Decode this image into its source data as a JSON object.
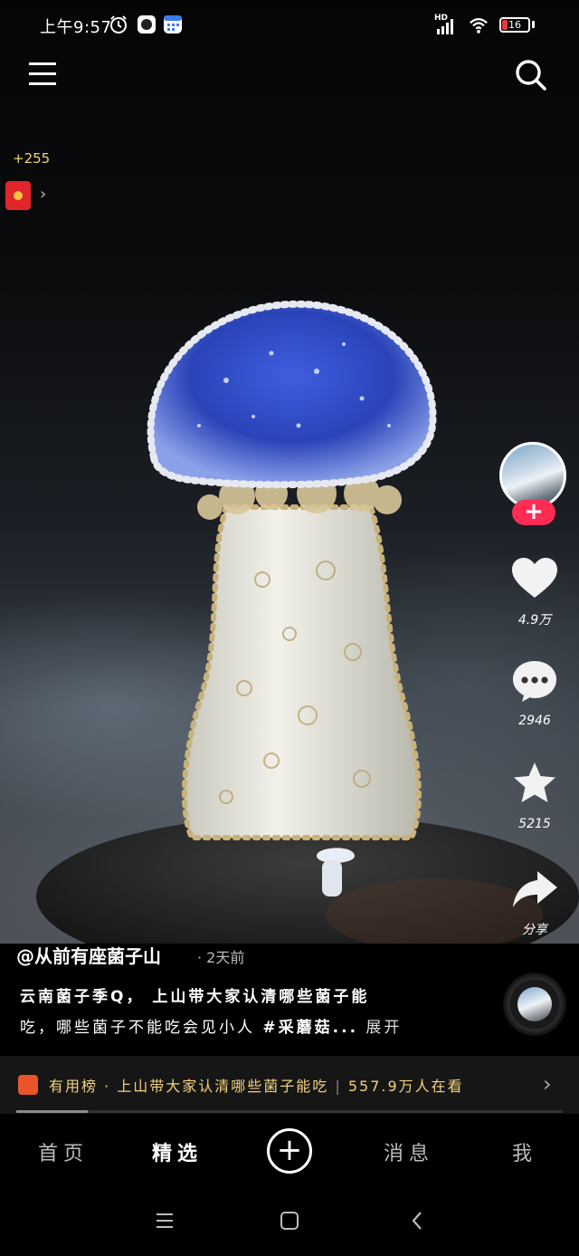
{
  "status_bar": {
    "time": "上午9:57",
    "network_label": "HD",
    "battery_level": "16"
  },
  "top": {
    "coin_reward": "+255"
  },
  "rail": {
    "likes": "4.9万",
    "comments": "2946",
    "favorites": "5215",
    "share": "分享"
  },
  "post": {
    "author": "@从前有座菌子山",
    "time_ago": "· 2天前",
    "desc_line1": "云南菌子季Q， 上山带大家认清哪些菌子能",
    "desc_line2_prefix": "吃，哪些菌子不能吃会见小人 ",
    "hashtag": "#采蘑菇...",
    "expand": " 展开"
  },
  "banner": {
    "prefix": "有用榜 · 上山带大家认清哪些菌子能吃",
    "viewers": "557.9万人在看"
  },
  "video_progress": 0.13,
  "nav": {
    "home": "首页",
    "featured": "精选",
    "messages": "消息",
    "me": "我"
  },
  "colors": {
    "accent": "#fe2c55",
    "cap_blue": "#2f4fd0",
    "banner_text": "#f3d27a"
  },
  "icons": [
    "alarm-icon",
    "record-icon",
    "calendar-icon",
    "signal-icon",
    "wifi-icon",
    "battery-icon",
    "menu-icon",
    "search-icon",
    "red-packet-icon",
    "heart-icon",
    "comment-icon",
    "star-icon",
    "share-icon",
    "add-icon",
    "recent-apps-icon",
    "home-icon",
    "back-icon"
  ]
}
